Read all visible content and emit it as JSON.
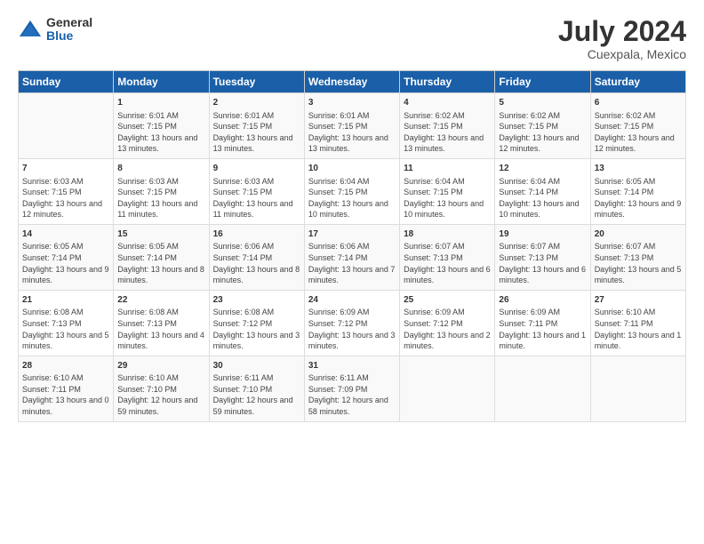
{
  "header": {
    "logo": {
      "general": "General",
      "blue": "Blue"
    },
    "title": "July 2024",
    "subtitle": "Cuexpala, Mexico"
  },
  "calendar": {
    "headers": [
      "Sunday",
      "Monday",
      "Tuesday",
      "Wednesday",
      "Thursday",
      "Friday",
      "Saturday"
    ],
    "weeks": [
      [
        {
          "day": "",
          "sunrise": "",
          "sunset": "",
          "daylight": ""
        },
        {
          "day": "1",
          "sunrise": "Sunrise: 6:01 AM",
          "sunset": "Sunset: 7:15 PM",
          "daylight": "Daylight: 13 hours and 13 minutes."
        },
        {
          "day": "2",
          "sunrise": "Sunrise: 6:01 AM",
          "sunset": "Sunset: 7:15 PM",
          "daylight": "Daylight: 13 hours and 13 minutes."
        },
        {
          "day": "3",
          "sunrise": "Sunrise: 6:01 AM",
          "sunset": "Sunset: 7:15 PM",
          "daylight": "Daylight: 13 hours and 13 minutes."
        },
        {
          "day": "4",
          "sunrise": "Sunrise: 6:02 AM",
          "sunset": "Sunset: 7:15 PM",
          "daylight": "Daylight: 13 hours and 13 minutes."
        },
        {
          "day": "5",
          "sunrise": "Sunrise: 6:02 AM",
          "sunset": "Sunset: 7:15 PM",
          "daylight": "Daylight: 13 hours and 12 minutes."
        },
        {
          "day": "6",
          "sunrise": "Sunrise: 6:02 AM",
          "sunset": "Sunset: 7:15 PM",
          "daylight": "Daylight: 13 hours and 12 minutes."
        }
      ],
      [
        {
          "day": "7",
          "sunrise": "Sunrise: 6:03 AM",
          "sunset": "Sunset: 7:15 PM",
          "daylight": "Daylight: 13 hours and 12 minutes."
        },
        {
          "day": "8",
          "sunrise": "Sunrise: 6:03 AM",
          "sunset": "Sunset: 7:15 PM",
          "daylight": "Daylight: 13 hours and 11 minutes."
        },
        {
          "day": "9",
          "sunrise": "Sunrise: 6:03 AM",
          "sunset": "Sunset: 7:15 PM",
          "daylight": "Daylight: 13 hours and 11 minutes."
        },
        {
          "day": "10",
          "sunrise": "Sunrise: 6:04 AM",
          "sunset": "Sunset: 7:15 PM",
          "daylight": "Daylight: 13 hours and 10 minutes."
        },
        {
          "day": "11",
          "sunrise": "Sunrise: 6:04 AM",
          "sunset": "Sunset: 7:15 PM",
          "daylight": "Daylight: 13 hours and 10 minutes."
        },
        {
          "day": "12",
          "sunrise": "Sunrise: 6:04 AM",
          "sunset": "Sunset: 7:14 PM",
          "daylight": "Daylight: 13 hours and 10 minutes."
        },
        {
          "day": "13",
          "sunrise": "Sunrise: 6:05 AM",
          "sunset": "Sunset: 7:14 PM",
          "daylight": "Daylight: 13 hours and 9 minutes."
        }
      ],
      [
        {
          "day": "14",
          "sunrise": "Sunrise: 6:05 AM",
          "sunset": "Sunset: 7:14 PM",
          "daylight": "Daylight: 13 hours and 9 minutes."
        },
        {
          "day": "15",
          "sunrise": "Sunrise: 6:05 AM",
          "sunset": "Sunset: 7:14 PM",
          "daylight": "Daylight: 13 hours and 8 minutes."
        },
        {
          "day": "16",
          "sunrise": "Sunrise: 6:06 AM",
          "sunset": "Sunset: 7:14 PM",
          "daylight": "Daylight: 13 hours and 8 minutes."
        },
        {
          "day": "17",
          "sunrise": "Sunrise: 6:06 AM",
          "sunset": "Sunset: 7:14 PM",
          "daylight": "Daylight: 13 hours and 7 minutes."
        },
        {
          "day": "18",
          "sunrise": "Sunrise: 6:07 AM",
          "sunset": "Sunset: 7:13 PM",
          "daylight": "Daylight: 13 hours and 6 minutes."
        },
        {
          "day": "19",
          "sunrise": "Sunrise: 6:07 AM",
          "sunset": "Sunset: 7:13 PM",
          "daylight": "Daylight: 13 hours and 6 minutes."
        },
        {
          "day": "20",
          "sunrise": "Sunrise: 6:07 AM",
          "sunset": "Sunset: 7:13 PM",
          "daylight": "Daylight: 13 hours and 5 minutes."
        }
      ],
      [
        {
          "day": "21",
          "sunrise": "Sunrise: 6:08 AM",
          "sunset": "Sunset: 7:13 PM",
          "daylight": "Daylight: 13 hours and 5 minutes."
        },
        {
          "day": "22",
          "sunrise": "Sunrise: 6:08 AM",
          "sunset": "Sunset: 7:13 PM",
          "daylight": "Daylight: 13 hours and 4 minutes."
        },
        {
          "day": "23",
          "sunrise": "Sunrise: 6:08 AM",
          "sunset": "Sunset: 7:12 PM",
          "daylight": "Daylight: 13 hours and 3 minutes."
        },
        {
          "day": "24",
          "sunrise": "Sunrise: 6:09 AM",
          "sunset": "Sunset: 7:12 PM",
          "daylight": "Daylight: 13 hours and 3 minutes."
        },
        {
          "day": "25",
          "sunrise": "Sunrise: 6:09 AM",
          "sunset": "Sunset: 7:12 PM",
          "daylight": "Daylight: 13 hours and 2 minutes."
        },
        {
          "day": "26",
          "sunrise": "Sunrise: 6:09 AM",
          "sunset": "Sunset: 7:11 PM",
          "daylight": "Daylight: 13 hours and 1 minute."
        },
        {
          "day": "27",
          "sunrise": "Sunrise: 6:10 AM",
          "sunset": "Sunset: 7:11 PM",
          "daylight": "Daylight: 13 hours and 1 minute."
        }
      ],
      [
        {
          "day": "28",
          "sunrise": "Sunrise: 6:10 AM",
          "sunset": "Sunset: 7:11 PM",
          "daylight": "Daylight: 13 hours and 0 minutes."
        },
        {
          "day": "29",
          "sunrise": "Sunrise: 6:10 AM",
          "sunset": "Sunset: 7:10 PM",
          "daylight": "Daylight: 12 hours and 59 minutes."
        },
        {
          "day": "30",
          "sunrise": "Sunrise: 6:11 AM",
          "sunset": "Sunset: 7:10 PM",
          "daylight": "Daylight: 12 hours and 59 minutes."
        },
        {
          "day": "31",
          "sunrise": "Sunrise: 6:11 AM",
          "sunset": "Sunset: 7:09 PM",
          "daylight": "Daylight: 12 hours and 58 minutes."
        },
        {
          "day": "",
          "sunrise": "",
          "sunset": "",
          "daylight": ""
        },
        {
          "day": "",
          "sunrise": "",
          "sunset": "",
          "daylight": ""
        },
        {
          "day": "",
          "sunrise": "",
          "sunset": "",
          "daylight": ""
        }
      ]
    ]
  }
}
